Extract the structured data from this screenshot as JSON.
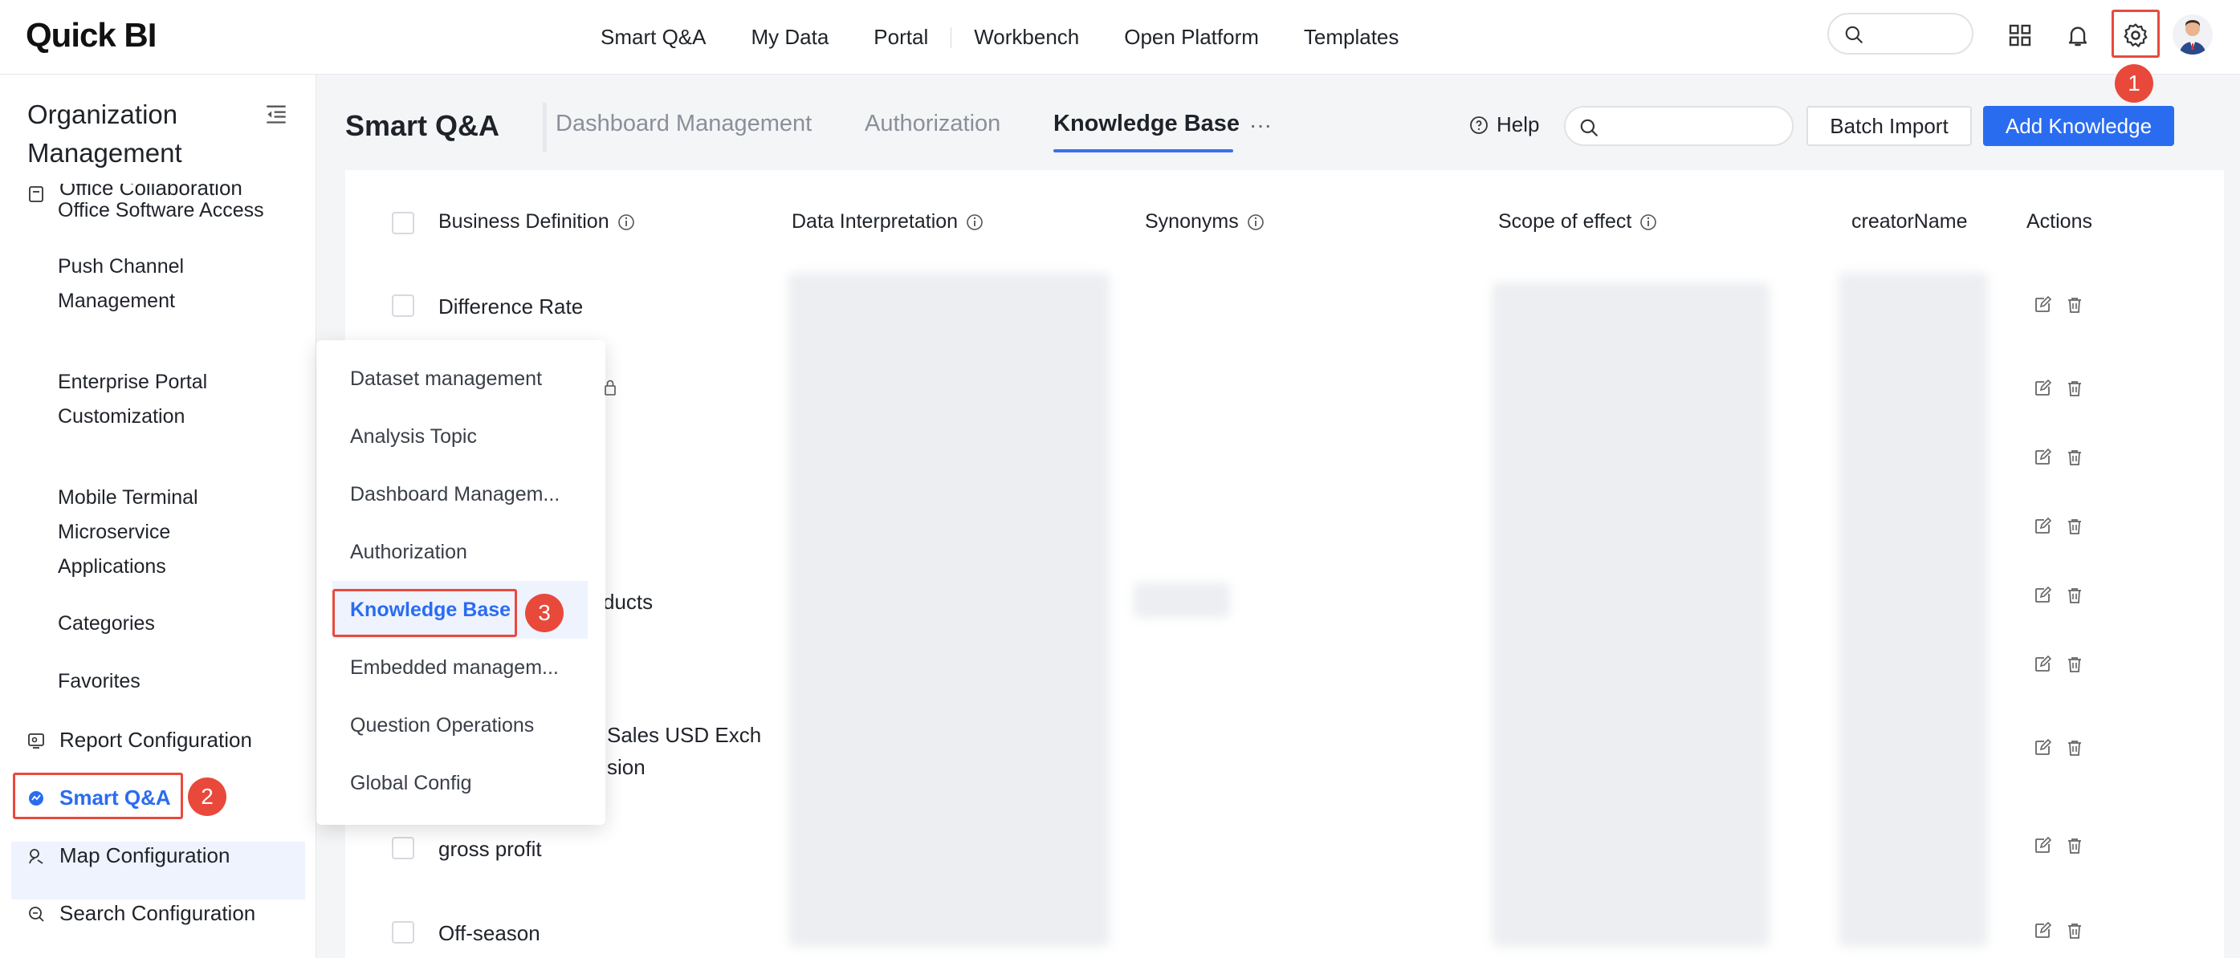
{
  "brand": {
    "logo_text": "Quick BI",
    "accent": "#2a6cf0",
    "highlight": "#e84a3c"
  },
  "topnav": [
    "Smart Q&A",
    "My Data",
    "Portal",
    "Workbench",
    "Open Platform",
    "Templates"
  ],
  "steps": {
    "one": "1",
    "two": "2",
    "three": "3"
  },
  "sidebar": {
    "title": "Organization Management",
    "clipped_group": "Office Collaboration",
    "sub_items": [
      "Office Software Access",
      "Push Channel Management",
      "Enterprise Portal Customization",
      "Mobile Terminal Microservice Applications",
      "Categories",
      "Favorites"
    ],
    "groups": [
      "Report Configuration",
      "Smart Q&A",
      "Map Configuration",
      "Search Configuration"
    ]
  },
  "header": {
    "title": "Smart Q&A",
    "tabs": [
      "Dashboard Management",
      "Authorization",
      "Knowledge Base"
    ],
    "more": "···",
    "help": "Help",
    "batch_import": "Batch Import",
    "add_knowledge": "Add Knowledge"
  },
  "table": {
    "columns": [
      "Business Definition",
      "Data Interpretation",
      "Synonyms",
      "Scope of effect",
      "creatorName",
      "Actions"
    ],
    "rows": [
      {
        "definition": "Difference Rate"
      },
      {
        "definition": ""
      },
      {
        "definition": ""
      },
      {
        "definition": ""
      },
      {
        "definition": "ducts"
      },
      {
        "definition": ""
      },
      {
        "definition_line1": "Sales USD Exch",
        "definition_line2": "sion"
      },
      {
        "definition": "gross profit"
      },
      {
        "definition": "Off-season"
      }
    ]
  },
  "menu": {
    "items": [
      "Dataset management",
      "Analysis Topic",
      "Dashboard Managem...",
      "Authorization",
      "Knowledge Base",
      "Embedded managem...",
      "Question Operations",
      "Global Config"
    ]
  }
}
